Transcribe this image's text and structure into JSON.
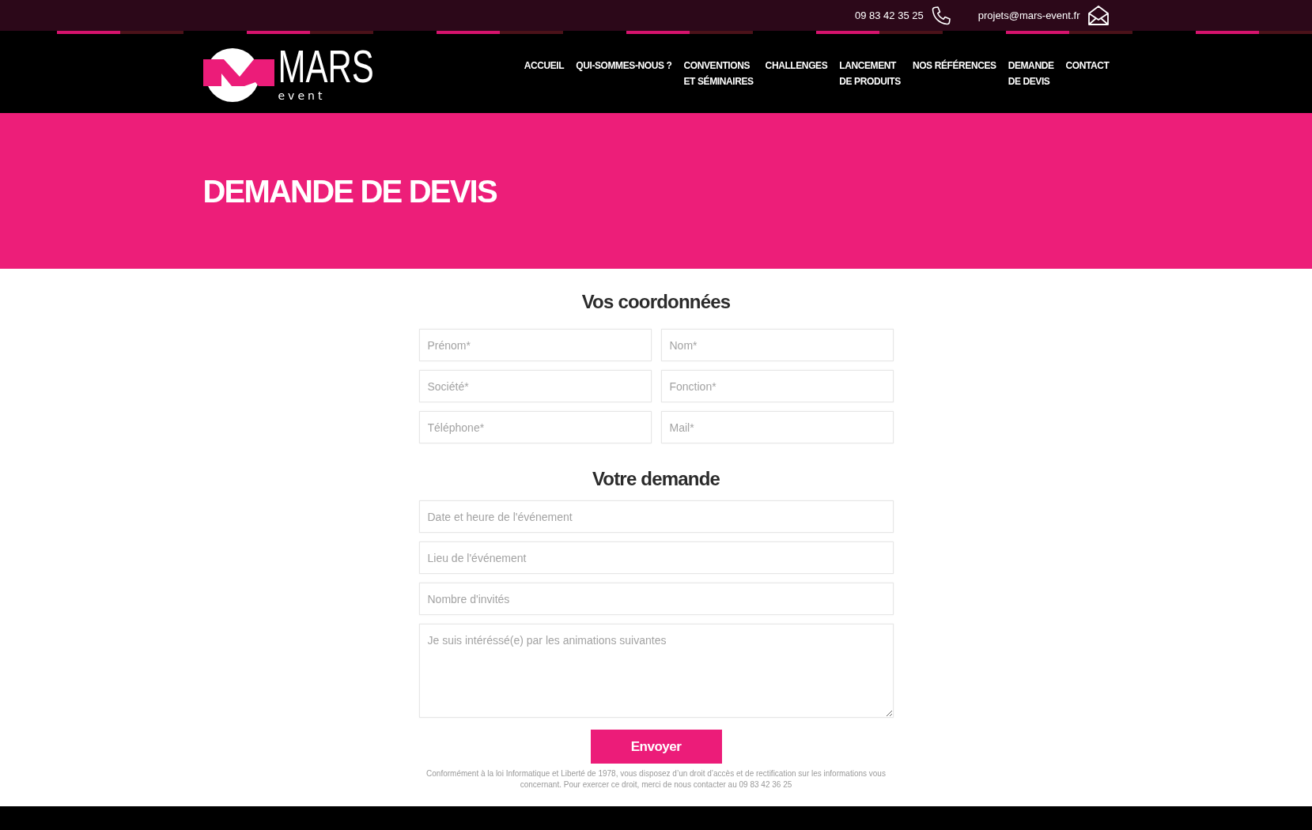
{
  "top_bar": {
    "phone": "09 83 42 35 25",
    "email": "projets@mars-event.fr"
  },
  "header": {
    "logo": {
      "wordmark": "MARS",
      "tagline": "event"
    },
    "nav": [
      {
        "lines": [
          "ACCUEIL"
        ]
      },
      {
        "lines": [
          "QUI-SOMMES-NOUS ?"
        ]
      },
      {
        "lines": [
          "CONVENTIONS",
          "ET SÉMINAIRES"
        ]
      },
      {
        "lines": [
          "CHALLENGES"
        ]
      },
      {
        "lines": [
          "LANCEMENT",
          "DE PRODUITS"
        ]
      },
      {
        "lines": [
          "NOS RÉFÉRENCES"
        ]
      },
      {
        "lines": [
          "DEMANDE",
          "DE DEVIS"
        ]
      },
      {
        "lines": [
          "CONTACT"
        ]
      }
    ]
  },
  "banner": {
    "title": "DEMANDE DE DEVIS"
  },
  "form": {
    "sections": [
      {
        "title": "Vos coordonnées",
        "fields": [
          {
            "kind": "half",
            "placeholder": "Prénom*"
          },
          {
            "kind": "half",
            "placeholder": "Nom*"
          },
          {
            "kind": "half",
            "placeholder": "Société*"
          },
          {
            "kind": "half",
            "placeholder": "Fonction*"
          },
          {
            "kind": "half",
            "placeholder": "Téléphone*"
          },
          {
            "kind": "half",
            "placeholder": "Mail*"
          }
        ]
      },
      {
        "title": "Votre demande",
        "fields": [
          {
            "kind": "full",
            "placeholder": "Date et heure de l'événement"
          },
          {
            "kind": "full",
            "placeholder": "Lieu de l'événement"
          },
          {
            "kind": "full",
            "placeholder": "Nombre d'invités"
          },
          {
            "kind": "textarea",
            "placeholder": "Je suis intéréssé(e) par les animations suivantes"
          }
        ]
      }
    ],
    "submit": "Envoyer",
    "legal": "Conformément à la loi Informatique et Liberté de 1978, vous disposez d’un droit d’accès et de rectification sur les informations vous concernant. Pour exercer ce droit, merci de nous contacter au 09 83 42 36 25"
  }
}
